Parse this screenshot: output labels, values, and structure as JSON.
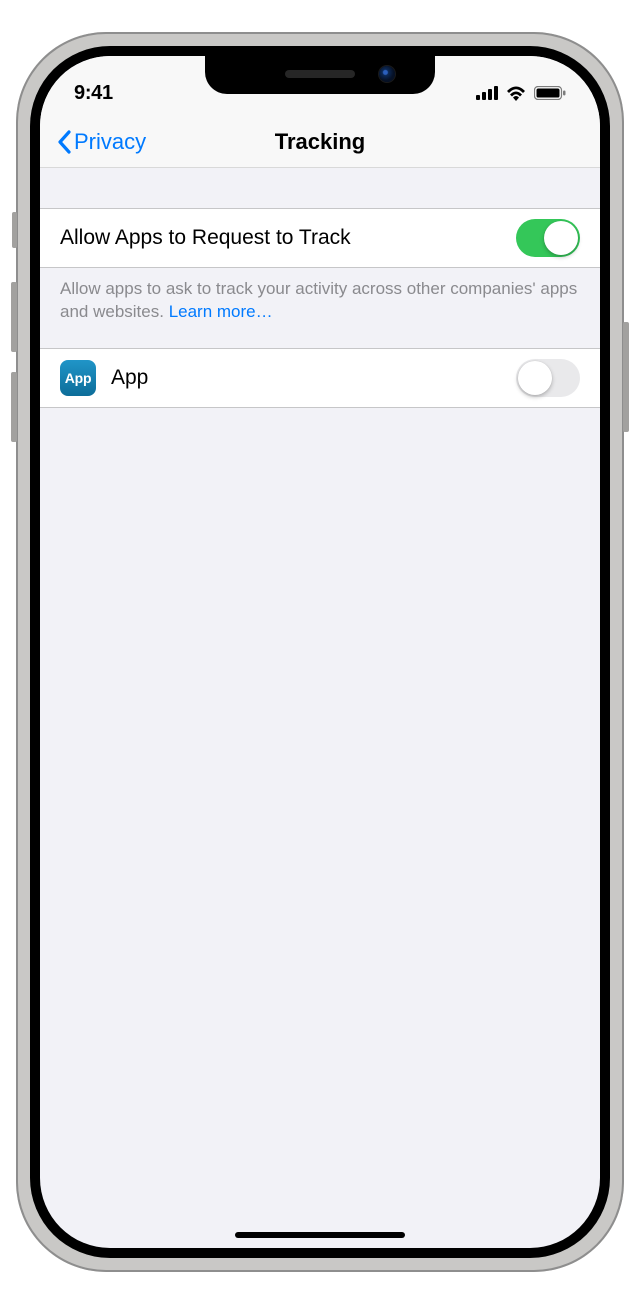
{
  "statusbar": {
    "time": "9:41"
  },
  "nav": {
    "back_label": "Privacy",
    "title": "Tracking"
  },
  "settings": {
    "allow_tracking": {
      "label": "Allow Apps to Request to Track",
      "enabled": true,
      "footer_text": "Allow apps to ask to track your activity across other companies' apps and websites. ",
      "learn_more": "Learn more…"
    },
    "apps": [
      {
        "icon_label": "App",
        "name": "App",
        "tracking_allowed": false
      }
    ]
  },
  "colors": {
    "accent": "#007aff",
    "switch_on": "#34c759",
    "switch_off": "#e9e9eb",
    "bg": "#f2f2f7"
  }
}
